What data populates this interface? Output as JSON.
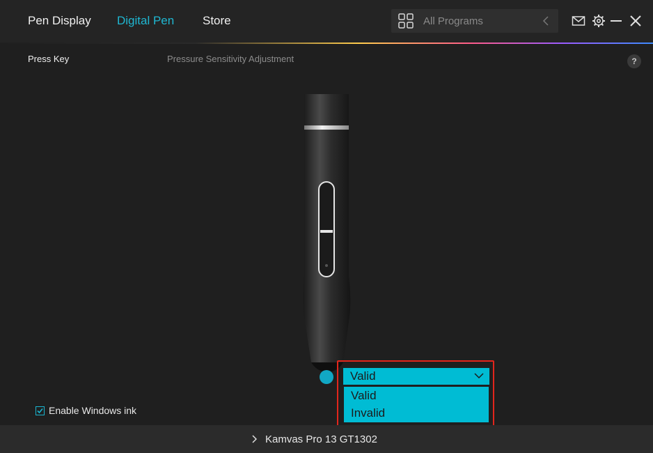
{
  "nav": {
    "tabs": [
      "Pen Display",
      "Digital Pen",
      "Store"
    ],
    "active": "Digital Pen"
  },
  "programs": {
    "label": "All Programs"
  },
  "subtabs": {
    "press_key": "Press Key",
    "pressure": "Pressure Sensitivity Adjustment"
  },
  "help": {
    "label": "?"
  },
  "tip_action": {
    "selected": "Valid",
    "options": [
      "Valid",
      "Invalid"
    ]
  },
  "windows_ink": {
    "label": "Enable Windows ink",
    "checked": true
  },
  "footer": {
    "device": "Kamvas Pro 13 GT1302"
  },
  "colors": {
    "accent": "#00bcd4",
    "active_tab": "#1fb7d2",
    "highlight": "#e3261c"
  },
  "icons": [
    "grid-icon",
    "chevron-left-icon",
    "mail-icon",
    "gear-icon",
    "minimize-icon",
    "close-icon",
    "chevron-down-icon",
    "check-icon",
    "chevron-right-icon"
  ]
}
